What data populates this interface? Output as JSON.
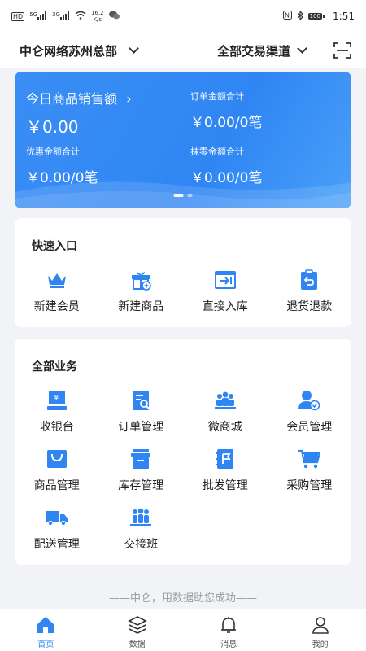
{
  "status": {
    "hd": "HD",
    "signal1": "5G",
    "signal2": "3G",
    "speed": "16.2\nK/s",
    "battery": "100",
    "time": "1:51"
  },
  "header": {
    "org": "中仑网络苏州总部",
    "channel": "全部交易渠道"
  },
  "sales": {
    "today_label": "今日商品销售额",
    "today_value": "￥0.00",
    "order_label": "订单金额合计",
    "order_value": "￥0.00/0笔",
    "discount_label": "优惠金额合计",
    "discount_value": "￥0.00/0笔",
    "rounding_label": "抹零金额合计",
    "rounding_value": "￥0.00/0笔"
  },
  "quick": {
    "title": "快速入口",
    "items": [
      {
        "label": "新建会员",
        "icon": "crown-icon"
      },
      {
        "label": "新建商品",
        "icon": "gift-box-icon"
      },
      {
        "label": "直接入库",
        "icon": "import-icon"
      },
      {
        "label": "退货退款",
        "icon": "return-icon"
      }
    ]
  },
  "business": {
    "title": "全部业务",
    "items": [
      {
        "label": "收银台",
        "icon": "cashier-icon"
      },
      {
        "label": "订单管理",
        "icon": "order-icon"
      },
      {
        "label": "微商城",
        "icon": "mall-icon"
      },
      {
        "label": "会员管理",
        "icon": "member-icon"
      },
      {
        "label": "商品管理",
        "icon": "bag-icon"
      },
      {
        "label": "库存管理",
        "icon": "inventory-icon"
      },
      {
        "label": "批发管理",
        "icon": "wholesale-icon"
      },
      {
        "label": "采购管理",
        "icon": "cart-icon"
      },
      {
        "label": "配送管理",
        "icon": "truck-icon"
      },
      {
        "label": "交接班",
        "icon": "shift-icon"
      }
    ]
  },
  "slogan": "——中仑，用数据助您成功——",
  "tabs": [
    {
      "label": "首页",
      "icon": "home-icon",
      "active": true
    },
    {
      "label": "数据",
      "icon": "layers-icon",
      "active": false
    },
    {
      "label": "消息",
      "icon": "bell-icon",
      "active": false
    },
    {
      "label": "我的",
      "icon": "user-icon",
      "active": false
    }
  ],
  "colors": {
    "accent": "#2f86f3",
    "icon_blue": "#2f86f3",
    "background": "#f1f3f6"
  }
}
